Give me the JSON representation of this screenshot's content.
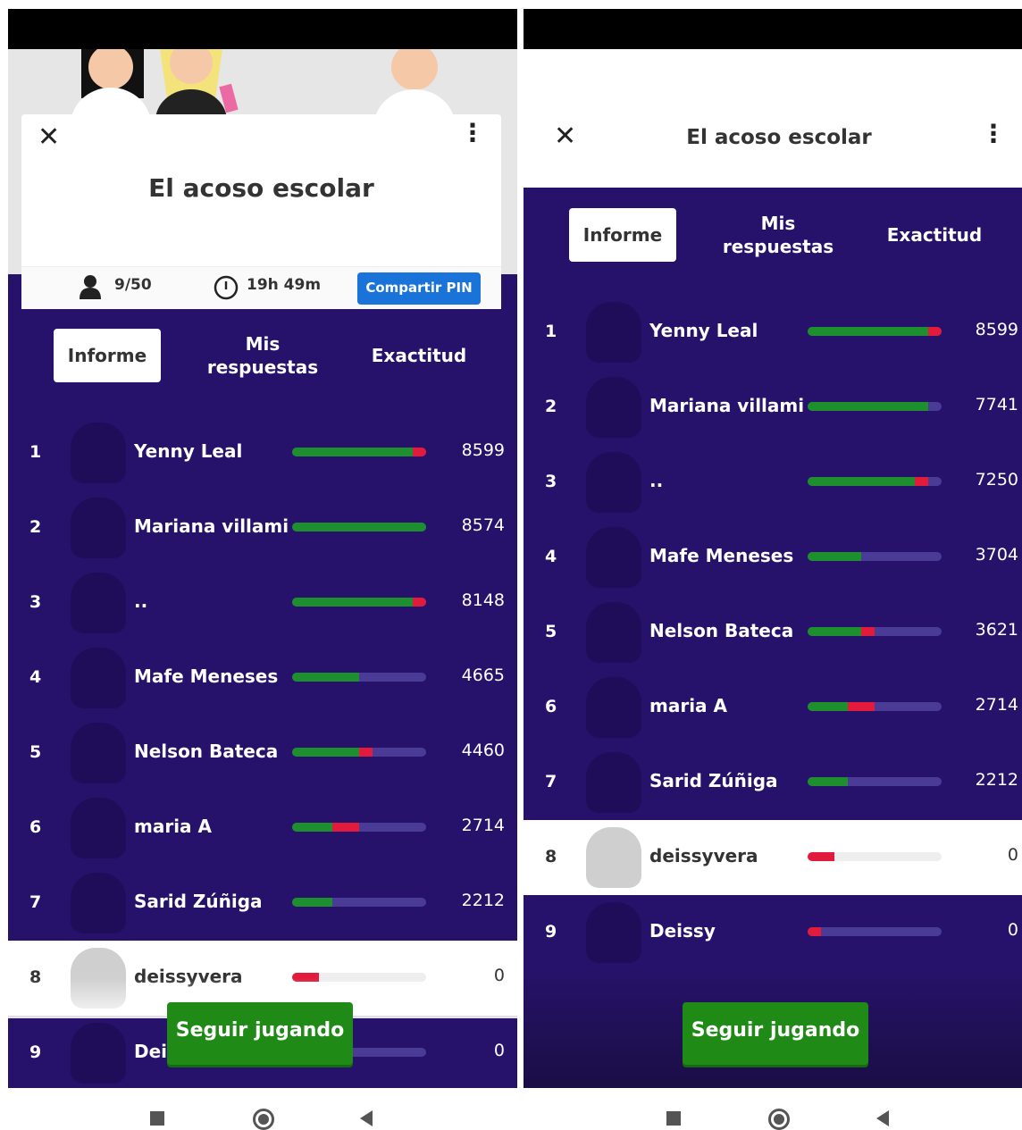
{
  "quiz_title": "El acoso escolar",
  "players_count": "9/50",
  "time_left": "19h 49m",
  "share_pin_label": "Compartir PIN",
  "tabs": [
    "Informe",
    "Mis respuestas",
    "Exactitud"
  ],
  "continue_label": "Seguir jugando",
  "close_icon": "✕",
  "menu_icon": "⋮",
  "colors": {
    "purple": "#27126b",
    "correct": "#1e8f2e",
    "incorrect": "#e21b3c",
    "pin_button": "#1a73d9",
    "continue_button": "#1f8a16"
  },
  "left": {
    "rows": [
      {
        "rank": "1",
        "name": "Yenny Leal",
        "score": "8599",
        "correct": 0.9,
        "incorrect": 0.1
      },
      {
        "rank": "2",
        "name": "Mariana villami",
        "score": "8574",
        "correct": 1.0,
        "incorrect": 0.0
      },
      {
        "rank": "3",
        "name": "..",
        "score": "8148",
        "correct": 0.9,
        "incorrect": 0.1
      },
      {
        "rank": "4",
        "name": "Mafe Meneses",
        "score": "4665",
        "correct": 0.5,
        "incorrect": 0.0
      },
      {
        "rank": "5",
        "name": "Nelson Bateca",
        "score": "4460",
        "correct": 0.5,
        "incorrect": 0.1
      },
      {
        "rank": "6",
        "name": "maria A",
        "score": "2714",
        "correct": 0.3,
        "incorrect": 0.2
      },
      {
        "rank": "7",
        "name": "Sarid Zúñiga",
        "score": "2212",
        "correct": 0.3,
        "incorrect": 0.0
      },
      {
        "rank": "8",
        "name": "deissyvera",
        "score": "0",
        "correct": 0.0,
        "incorrect": 0.2
      },
      {
        "rank": "9",
        "name": "Deissy",
        "score": "0",
        "correct": 0.0,
        "incorrect": 0.1
      }
    ]
  },
  "right": {
    "rows": [
      {
        "rank": "1",
        "name": "Yenny Leal",
        "score": "8599",
        "correct": 0.9,
        "incorrect": 0.1
      },
      {
        "rank": "2",
        "name": "Mariana villami",
        "score": "7741",
        "correct": 0.9,
        "incorrect": 0.0
      },
      {
        "rank": "3",
        "name": "..",
        "score": "7250",
        "correct": 0.8,
        "incorrect": 0.1
      },
      {
        "rank": "4",
        "name": "Mafe Meneses",
        "score": "3704",
        "correct": 0.4,
        "incorrect": 0.0
      },
      {
        "rank": "5",
        "name": "Nelson Bateca",
        "score": "3621",
        "correct": 0.4,
        "incorrect": 0.1
      },
      {
        "rank": "6",
        "name": "maria A",
        "score": "2714",
        "correct": 0.3,
        "incorrect": 0.2
      },
      {
        "rank": "7",
        "name": "Sarid Zúñiga",
        "score": "2212",
        "correct": 0.3,
        "incorrect": 0.0
      },
      {
        "rank": "8",
        "name": "deissyvera",
        "score": "0",
        "correct": 0.0,
        "incorrect": 0.2
      },
      {
        "rank": "9",
        "name": "Deissy",
        "score": "0",
        "correct": 0.0,
        "incorrect": 0.1
      }
    ]
  }
}
